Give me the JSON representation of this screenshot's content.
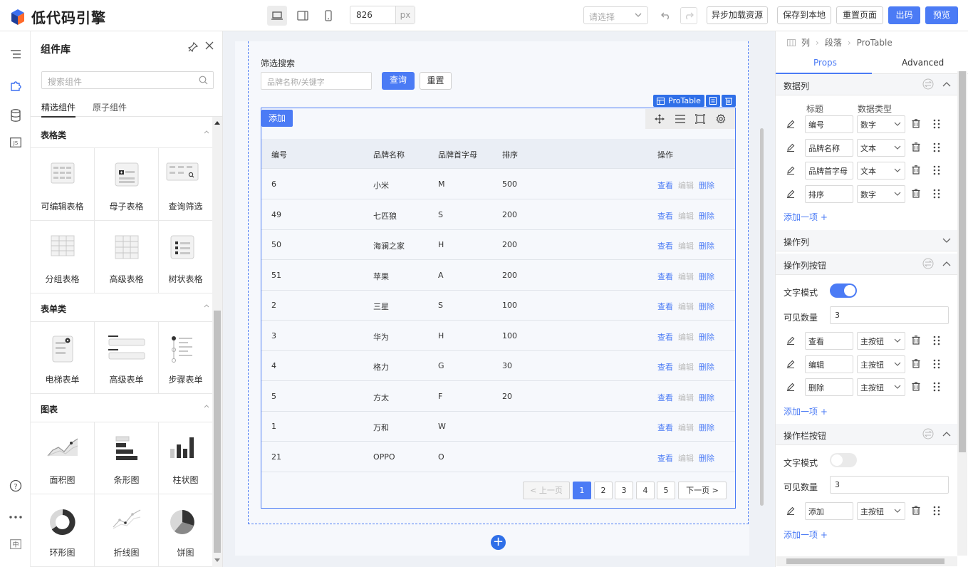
{
  "brand": {
    "name": "低代码引擎",
    "accent": "#4b7bf5"
  },
  "topbar": {
    "width_value": "826",
    "width_unit": "px",
    "select_placeholder": "请选择",
    "buttons": {
      "async": "异步加载资源",
      "save": "保存到本地",
      "reset": "重置页面",
      "code": "出码",
      "preview": "预览"
    }
  },
  "library": {
    "title": "组件库",
    "search_placeholder": "搜索组件",
    "tabs": [
      "精选组件",
      "原子组件"
    ],
    "categories": [
      {
        "name": "表格类",
        "items": [
          "可编辑表格",
          "母子表格",
          "查询筛选",
          "分组表格",
          "高级表格",
          "树状表格"
        ]
      },
      {
        "name": "表单类",
        "items": [
          "电梯表单",
          "高级表单",
          "步骤表单"
        ]
      },
      {
        "name": "图表",
        "items": [
          "面积图",
          "条形图",
          "柱状图",
          "环形图",
          "折线图",
          "饼图"
        ]
      }
    ]
  },
  "canvas": {
    "filter_title": "筛选搜索",
    "filter_placeholder": "品牌名称/关键字",
    "query_label": "查询",
    "reset_label": "重置",
    "component_tag": "ProTable",
    "add_label": "添加",
    "columns": [
      "编号",
      "品牌名称",
      "品牌首字母",
      "排序",
      "操作"
    ],
    "actions": [
      "查看",
      "编辑",
      "删除"
    ],
    "rows": [
      [
        "6",
        "小米",
        "M",
        "500"
      ],
      [
        "49",
        "七匹狼",
        "S",
        "200"
      ],
      [
        "50",
        "海澜之家",
        "H",
        "200"
      ],
      [
        "51",
        "苹果",
        "A",
        "200"
      ],
      [
        "2",
        "三星",
        "S",
        "100"
      ],
      [
        "3",
        "华为",
        "H",
        "100"
      ],
      [
        "4",
        "格力",
        "G",
        "30"
      ],
      [
        "5",
        "方太",
        "F",
        "20"
      ],
      [
        "1",
        "万和",
        "W",
        ""
      ],
      [
        "21",
        "OPPO",
        "O",
        ""
      ]
    ],
    "pagination": {
      "prev": "< 上一页",
      "pages": [
        "1",
        "2",
        "3",
        "4",
        "5"
      ],
      "next": "下一页 >"
    }
  },
  "props": {
    "breadcrumb": [
      "列",
      "段落",
      "ProTable"
    ],
    "tabs": [
      "Props",
      "Advanced"
    ],
    "sections": {
      "data_columns": "数据列",
      "action_column": "操作列",
      "action_column_buttons": "操作列按钮",
      "toolbar_buttons": "操作栏按钮"
    },
    "col_headers": {
      "title": "标题",
      "type": "数据类型"
    },
    "data_rows": [
      {
        "title": "编号",
        "type": "数字"
      },
      {
        "title": "品牌名称",
        "type": "文本"
      },
      {
        "title": "品牌首字母",
        "type": "文本"
      },
      {
        "title": "排序",
        "type": "数字"
      }
    ],
    "add_item": "添加一项 +",
    "text_mode": "文字模式",
    "visible_count": "可见数量",
    "action_visible_value": "3",
    "action_buttons": [
      {
        "title": "查看",
        "type": "主按钮"
      },
      {
        "title": "编辑",
        "type": "主按钮"
      },
      {
        "title": "删除",
        "type": "主按钮"
      }
    ],
    "toolbar_visible_value": "3",
    "toolbar_buttons": [
      {
        "title": "添加",
        "type": "主按钮"
      }
    ]
  }
}
